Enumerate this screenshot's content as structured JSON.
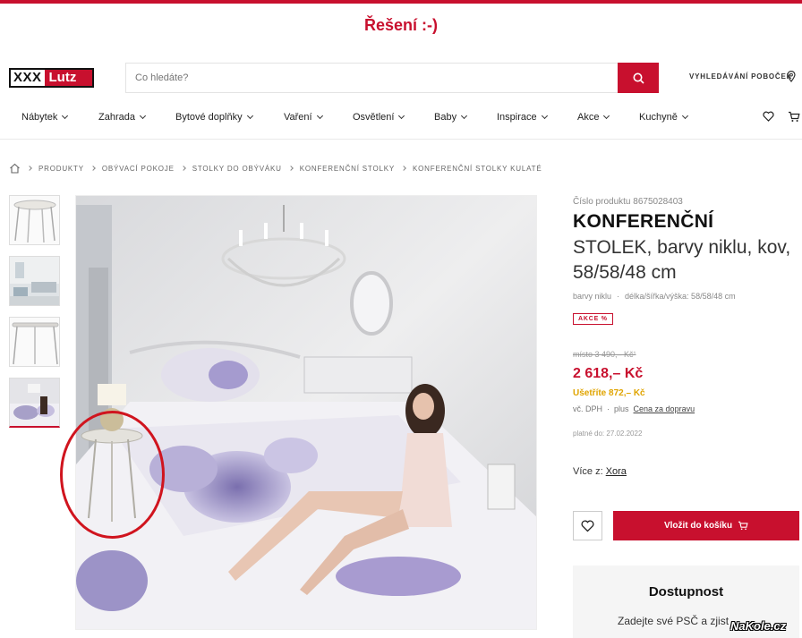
{
  "banner": {
    "title": "Řešení :-)"
  },
  "header": {
    "logo_left": "XXX",
    "logo_right": "Lutz",
    "search_placeholder": "Co hledáte?",
    "branch_search": "VYHLEDÁVÁNÍ POBOČEK"
  },
  "nav": {
    "items": [
      {
        "label": "Nábytek"
      },
      {
        "label": "Zahrada"
      },
      {
        "label": "Bytové doplňky"
      },
      {
        "label": "Vaření"
      },
      {
        "label": "Osvětlení"
      },
      {
        "label": "Baby"
      },
      {
        "label": "Inspirace"
      },
      {
        "label": "Akce"
      },
      {
        "label": "Kuchyně"
      }
    ]
  },
  "breadcrumb": [
    "PRODUKTY",
    "OBÝVACÍ POKOJE",
    "STOLKY DO OBÝVÁKU",
    "KONFERENČNÍ STOLKY",
    "KONFERENČNÍ STOLKY KULATÉ"
  ],
  "product": {
    "sku_label": "Číslo produktu 8675028403",
    "title_bold": "KONFERENČNÍ",
    "title_rest": "STOLEK, barvy niklu, kov, 58/58/48 cm",
    "color": "barvy niklu",
    "dims": "délka/šířka/výška: 58/58/48 cm",
    "badge": "AKCE %",
    "old_price": "místo 3 490,– Kč¹",
    "price": "2 618,– Kč",
    "savings": "Ušetříte 872,– Kč",
    "vat": "vč. DPH",
    "plus": "plus",
    "shipping": "Cena za dopravu",
    "valid": "platné do: 27.02.2022",
    "more_from_label": "Více z:",
    "more_from_brand": "Xora",
    "add_to_cart": "Vložit do košíku"
  },
  "availability": {
    "title": "Dostupnost",
    "text": "Zadejte své PSČ a zjist"
  },
  "watermark": "NaKole.cz",
  "colors": {
    "brand_red": "#c8102e",
    "savings": "#e0a400",
    "circle": "#d0141e"
  }
}
